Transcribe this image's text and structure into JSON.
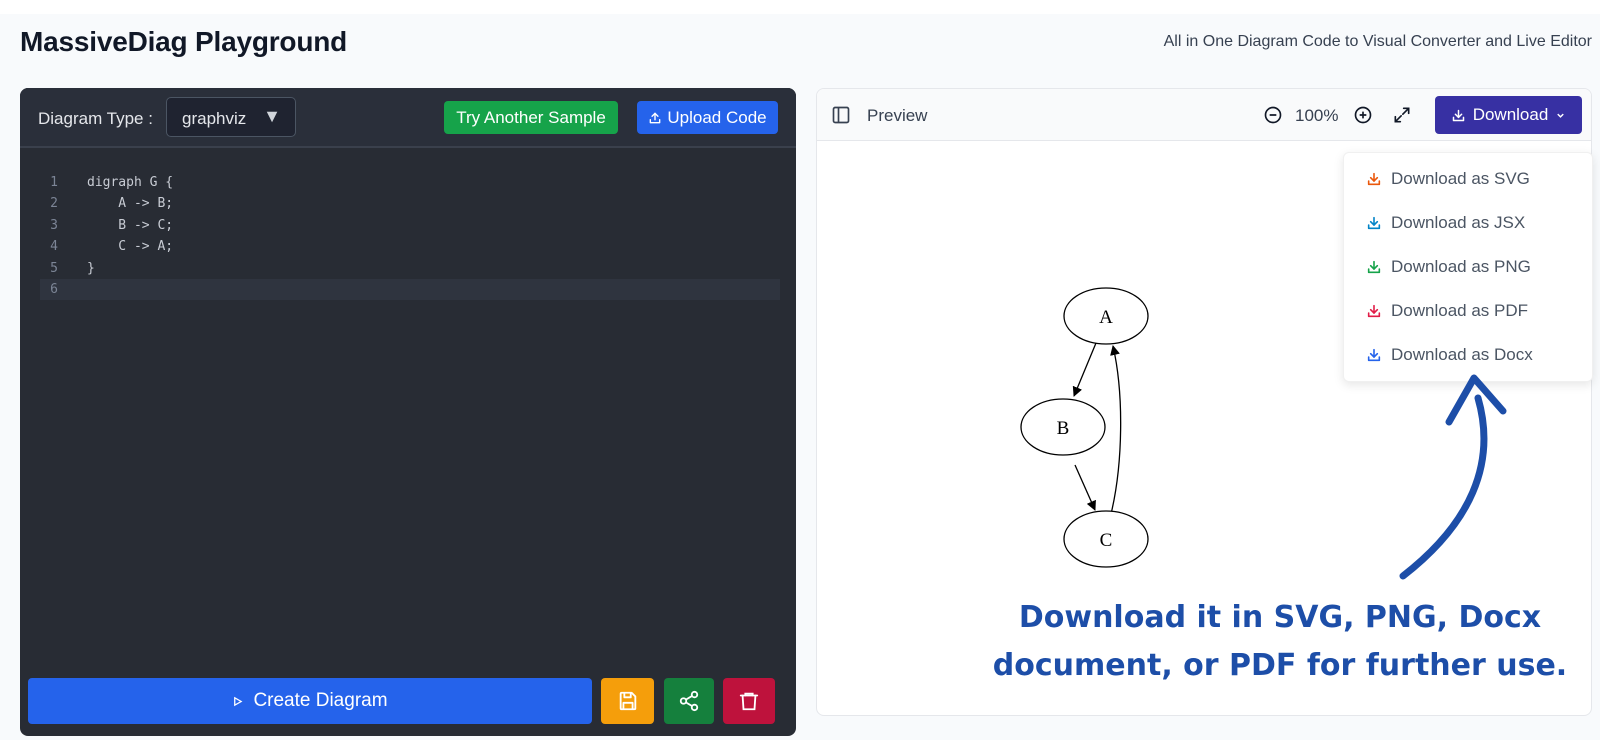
{
  "header": {
    "title": "MassiveDiag Playground",
    "subtitle": "All in One Diagram Code to Visual Converter and Live Editor"
  },
  "editor": {
    "type_label": "Diagram Type :",
    "diagram_type": "graphviz",
    "try_sample_label": "Try Another Sample",
    "upload_label": "Upload Code",
    "code_lines": [
      {
        "no": "1",
        "text": "digraph G {"
      },
      {
        "no": "2",
        "text": "    A -> B;"
      },
      {
        "no": "3",
        "text": "    B -> C;"
      },
      {
        "no": "4",
        "text": "    C -> A;"
      },
      {
        "no": "5",
        "text": "}"
      },
      {
        "no": "6",
        "text": ""
      }
    ],
    "create_label": "Create Diagram"
  },
  "preview": {
    "label": "Preview",
    "zoom": "100%",
    "download_label": "Download",
    "download_menu": [
      {
        "label": "Download as SVG",
        "color": "#ea580c"
      },
      {
        "label": "Download as JSX",
        "color": "#0284c7"
      },
      {
        "label": "Download as PNG",
        "color": "#16a34a"
      },
      {
        "label": "Download as PDF",
        "color": "#e11d48"
      },
      {
        "label": "Download as Docx",
        "color": "#2563eb"
      }
    ],
    "diagram_nodes": [
      "A",
      "B",
      "C"
    ]
  },
  "annotation": {
    "line1": "Download it in SVG, PNG, Docx",
    "line2": "document, or PDF for further use."
  },
  "colors": {
    "accent_blue": "#2563eb",
    "success_green": "#16a34a",
    "download_indigo": "#3730a3",
    "annotation_blue": "#1d4ea8"
  }
}
